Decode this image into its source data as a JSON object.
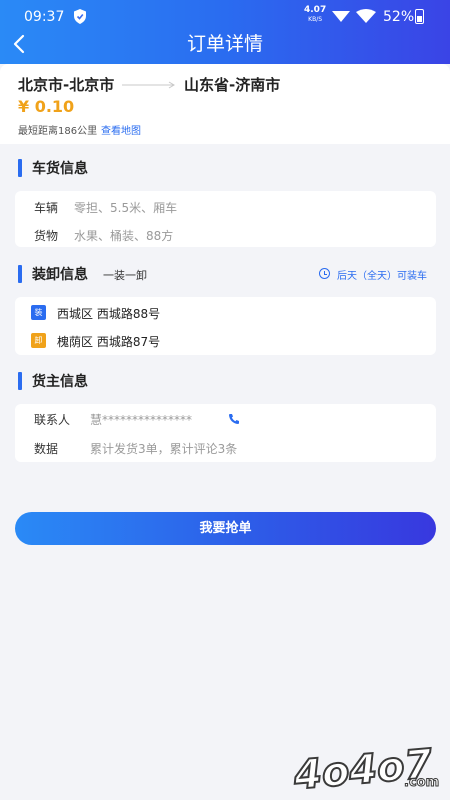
{
  "status_bar": {
    "time": "09:37",
    "net_speed_value": "4.07",
    "net_speed_unit": "KB/S",
    "battery_percent": "52%"
  },
  "nav": {
    "title": "订单详情"
  },
  "route": {
    "from": "北京市-北京市",
    "to": "山东省-济南市",
    "price": "¥ 0.10",
    "distance": "最短距离186公里",
    "map_link": "查看地图"
  },
  "cargo_section": {
    "title": "车货信息",
    "rows": [
      {
        "label": "车辆",
        "value": "零担、5.5米、厢车"
      },
      {
        "label": "货物",
        "value": "水果、桶装、88方"
      }
    ]
  },
  "loading_section": {
    "title": "装卸信息",
    "subtitle": "一装一卸",
    "time_note": "后天（全天）可装车",
    "stops": [
      {
        "badge": "装",
        "badge_color": "#2a6cf0",
        "address": "西城区 西城路88号"
      },
      {
        "badge": "卸",
        "badge_color": "#f0a21a",
        "address": "槐荫区 西城路87号"
      }
    ]
  },
  "owner_section": {
    "title": "货主信息",
    "contact_label": "联系人",
    "contact_value": "慧***************",
    "data_label": "数据",
    "data_value": "累计发货3单，累计评论3条"
  },
  "cta": {
    "label": "我要抢单"
  },
  "watermark": {
    "text": "4o4o7",
    "suffix": ".com"
  },
  "colors": {
    "accent": "#2a6cf0",
    "price": "#f0a21a"
  }
}
